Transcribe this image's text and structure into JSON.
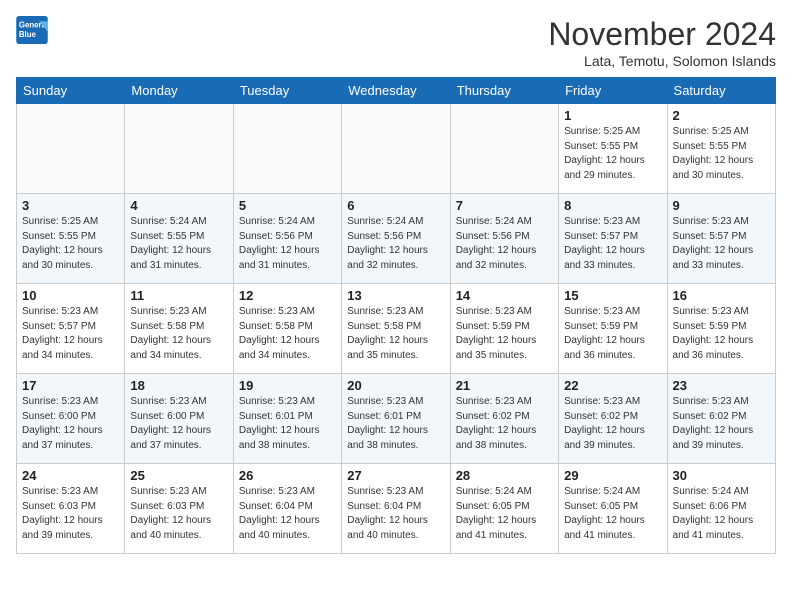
{
  "header": {
    "logo_line1": "General",
    "logo_line2": "Blue",
    "title": "November 2024",
    "subtitle": "Lata, Temotu, Solomon Islands"
  },
  "weekdays": [
    "Sunday",
    "Monday",
    "Tuesday",
    "Wednesday",
    "Thursday",
    "Friday",
    "Saturday"
  ],
  "weeks": [
    [
      {
        "day": "",
        "info": ""
      },
      {
        "day": "",
        "info": ""
      },
      {
        "day": "",
        "info": ""
      },
      {
        "day": "",
        "info": ""
      },
      {
        "day": "",
        "info": ""
      },
      {
        "day": "1",
        "info": "Sunrise: 5:25 AM\nSunset: 5:55 PM\nDaylight: 12 hours\nand 29 minutes."
      },
      {
        "day": "2",
        "info": "Sunrise: 5:25 AM\nSunset: 5:55 PM\nDaylight: 12 hours\nand 30 minutes."
      }
    ],
    [
      {
        "day": "3",
        "info": "Sunrise: 5:25 AM\nSunset: 5:55 PM\nDaylight: 12 hours\nand 30 minutes."
      },
      {
        "day": "4",
        "info": "Sunrise: 5:24 AM\nSunset: 5:55 PM\nDaylight: 12 hours\nand 31 minutes."
      },
      {
        "day": "5",
        "info": "Sunrise: 5:24 AM\nSunset: 5:56 PM\nDaylight: 12 hours\nand 31 minutes."
      },
      {
        "day": "6",
        "info": "Sunrise: 5:24 AM\nSunset: 5:56 PM\nDaylight: 12 hours\nand 32 minutes."
      },
      {
        "day": "7",
        "info": "Sunrise: 5:24 AM\nSunset: 5:56 PM\nDaylight: 12 hours\nand 32 minutes."
      },
      {
        "day": "8",
        "info": "Sunrise: 5:23 AM\nSunset: 5:57 PM\nDaylight: 12 hours\nand 33 minutes."
      },
      {
        "day": "9",
        "info": "Sunrise: 5:23 AM\nSunset: 5:57 PM\nDaylight: 12 hours\nand 33 minutes."
      }
    ],
    [
      {
        "day": "10",
        "info": "Sunrise: 5:23 AM\nSunset: 5:57 PM\nDaylight: 12 hours\nand 34 minutes."
      },
      {
        "day": "11",
        "info": "Sunrise: 5:23 AM\nSunset: 5:58 PM\nDaylight: 12 hours\nand 34 minutes."
      },
      {
        "day": "12",
        "info": "Sunrise: 5:23 AM\nSunset: 5:58 PM\nDaylight: 12 hours\nand 34 minutes."
      },
      {
        "day": "13",
        "info": "Sunrise: 5:23 AM\nSunset: 5:58 PM\nDaylight: 12 hours\nand 35 minutes."
      },
      {
        "day": "14",
        "info": "Sunrise: 5:23 AM\nSunset: 5:59 PM\nDaylight: 12 hours\nand 35 minutes."
      },
      {
        "day": "15",
        "info": "Sunrise: 5:23 AM\nSunset: 5:59 PM\nDaylight: 12 hours\nand 36 minutes."
      },
      {
        "day": "16",
        "info": "Sunrise: 5:23 AM\nSunset: 5:59 PM\nDaylight: 12 hours\nand 36 minutes."
      }
    ],
    [
      {
        "day": "17",
        "info": "Sunrise: 5:23 AM\nSunset: 6:00 PM\nDaylight: 12 hours\nand 37 minutes."
      },
      {
        "day": "18",
        "info": "Sunrise: 5:23 AM\nSunset: 6:00 PM\nDaylight: 12 hours\nand 37 minutes."
      },
      {
        "day": "19",
        "info": "Sunrise: 5:23 AM\nSunset: 6:01 PM\nDaylight: 12 hours\nand 38 minutes."
      },
      {
        "day": "20",
        "info": "Sunrise: 5:23 AM\nSunset: 6:01 PM\nDaylight: 12 hours\nand 38 minutes."
      },
      {
        "day": "21",
        "info": "Sunrise: 5:23 AM\nSunset: 6:02 PM\nDaylight: 12 hours\nand 38 minutes."
      },
      {
        "day": "22",
        "info": "Sunrise: 5:23 AM\nSunset: 6:02 PM\nDaylight: 12 hours\nand 39 minutes."
      },
      {
        "day": "23",
        "info": "Sunrise: 5:23 AM\nSunset: 6:02 PM\nDaylight: 12 hours\nand 39 minutes."
      }
    ],
    [
      {
        "day": "24",
        "info": "Sunrise: 5:23 AM\nSunset: 6:03 PM\nDaylight: 12 hours\nand 39 minutes."
      },
      {
        "day": "25",
        "info": "Sunrise: 5:23 AM\nSunset: 6:03 PM\nDaylight: 12 hours\nand 40 minutes."
      },
      {
        "day": "26",
        "info": "Sunrise: 5:23 AM\nSunset: 6:04 PM\nDaylight: 12 hours\nand 40 minutes."
      },
      {
        "day": "27",
        "info": "Sunrise: 5:23 AM\nSunset: 6:04 PM\nDaylight: 12 hours\nand 40 minutes."
      },
      {
        "day": "28",
        "info": "Sunrise: 5:24 AM\nSunset: 6:05 PM\nDaylight: 12 hours\nand 41 minutes."
      },
      {
        "day": "29",
        "info": "Sunrise: 5:24 AM\nSunset: 6:05 PM\nDaylight: 12 hours\nand 41 minutes."
      },
      {
        "day": "30",
        "info": "Sunrise: 5:24 AM\nSunset: 6:06 PM\nDaylight: 12 hours\nand 41 minutes."
      }
    ]
  ]
}
